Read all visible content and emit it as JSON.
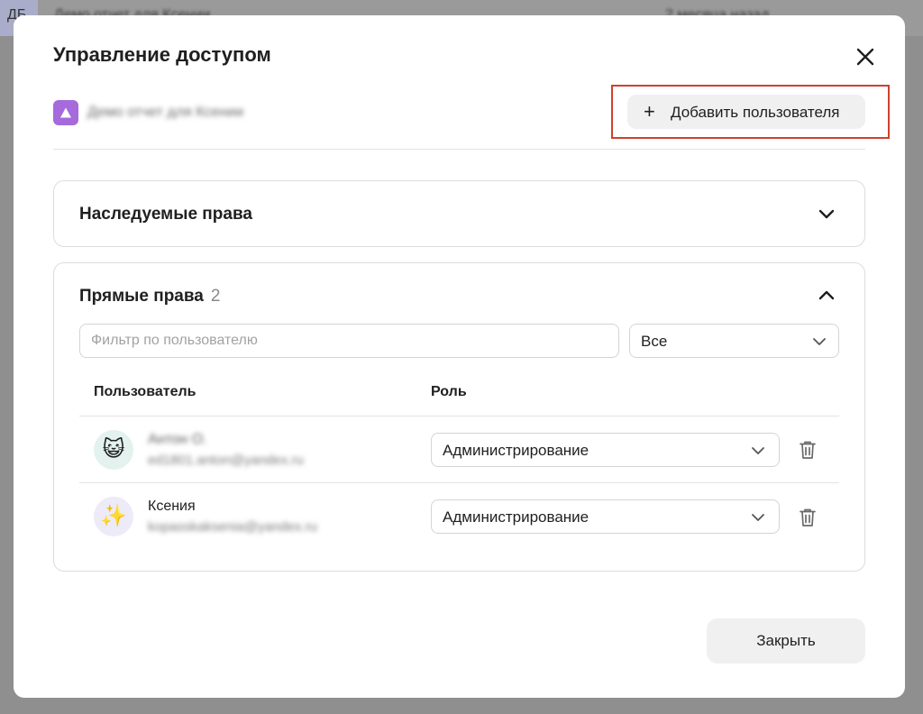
{
  "backdrop": {
    "avatar_initials": "ДБ",
    "title": "Демо отчет для Ксении",
    "date": "2 месяца назад"
  },
  "modal": {
    "title": "Управление доступом",
    "object_name": "Демо отчет для Ксении",
    "add_user_label": "Добавить пользователя",
    "inherited": {
      "title": "Наследуемые права"
    },
    "direct": {
      "title": "Прямые права",
      "count": "2",
      "filter_placeholder": "Фильтр по пользователю",
      "scope_value": "Все",
      "columns": {
        "user": "Пользователь",
        "role": "Роль"
      },
      "rows": [
        {
          "name": "Антон О.",
          "email": "ed1801.anton@yandex.ru",
          "avatar_emoji": "😺",
          "role": "Администрирование"
        },
        {
          "name": "Ксения",
          "email": "kopasskaksenia@yandex.ru",
          "avatar_emoji": "✨",
          "role": "Администрирование"
        }
      ]
    },
    "close_label": "Закрыть"
  },
  "colors": {
    "highlight": "#d0402d",
    "object_icon": "#a56bdc",
    "button_bg": "#f0f0f0"
  }
}
